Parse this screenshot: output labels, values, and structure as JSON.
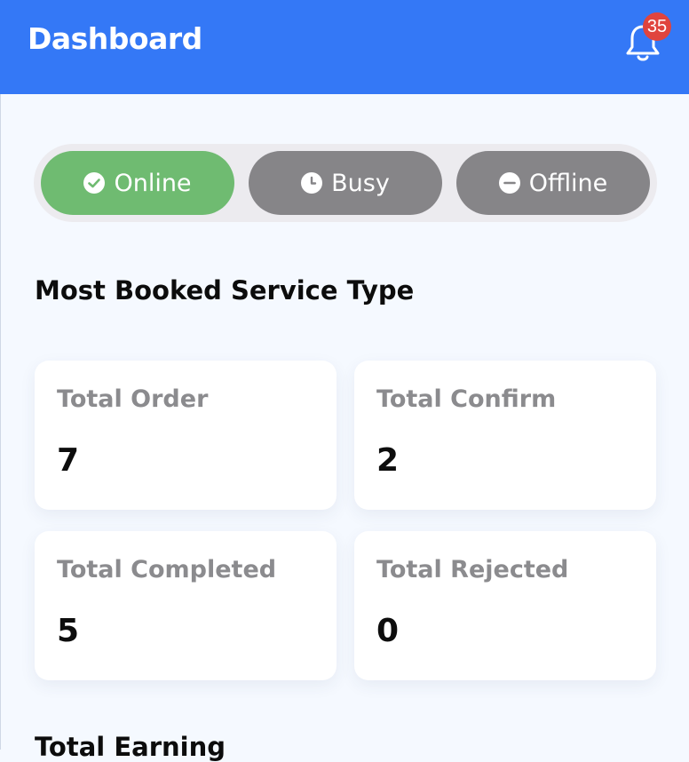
{
  "header": {
    "title": "Dashboard",
    "notification_count": "35",
    "icon": "bell-icon"
  },
  "status": {
    "selected": "Online",
    "options": [
      {
        "label": "Online",
        "icon": "check-circle-icon",
        "color": "#6fbb71"
      },
      {
        "label": "Busy",
        "icon": "clock-icon",
        "color": "#868588"
      },
      {
        "label": "Offline",
        "icon": "minus-circle-icon",
        "color": "#868588"
      }
    ]
  },
  "main": {
    "section_title": "Most Booked Service Type",
    "stats": [
      {
        "label": "Total Order",
        "value": "7"
      },
      {
        "label": "Total Confirm",
        "value": "2"
      },
      {
        "label": "Total Completed",
        "value": "5"
      },
      {
        "label": "Total Rejected",
        "value": "0"
      }
    ],
    "earning_title": "Total Earning"
  },
  "colors": {
    "accent": "#3478f6",
    "badge": "#e0443e",
    "background": "#f5f9ff"
  }
}
